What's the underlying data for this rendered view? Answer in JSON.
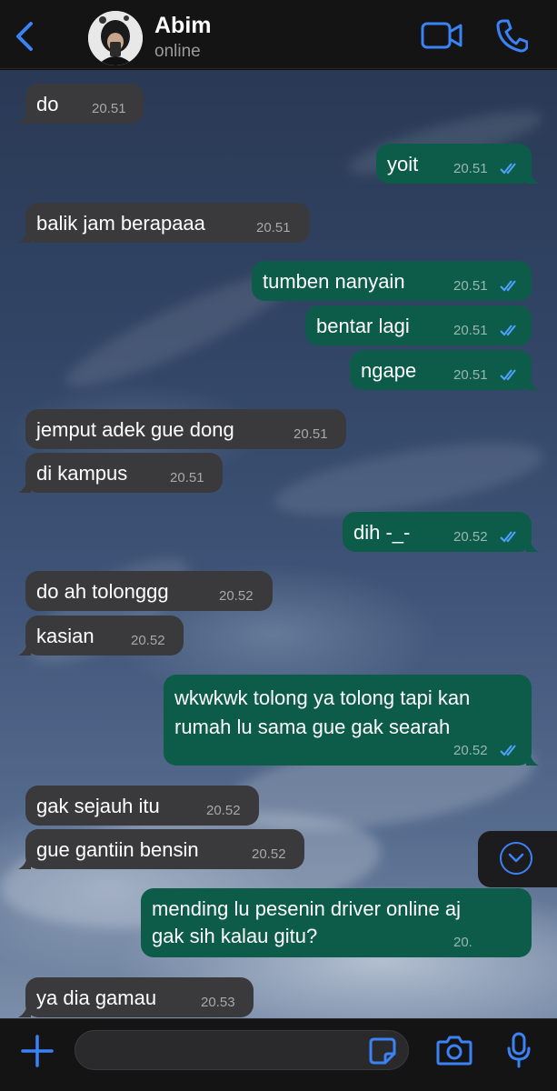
{
  "header": {
    "contact_name": "Abim",
    "status": "online"
  },
  "colors": {
    "accent": "#3b82f6",
    "incoming_bubble": "#3a3a3c",
    "outgoing_bubble": "#0d5c4a",
    "read_tick": "#4da3ff"
  },
  "messages": [
    {
      "dir": "in",
      "text": "do",
      "time": "20.51"
    },
    {
      "dir": "out",
      "text": "yoit",
      "time": "20.51",
      "status": "read"
    },
    {
      "dir": "in",
      "text": "balik jam berapaaa",
      "time": "20.51"
    },
    {
      "dir": "out",
      "text": "tumben nanyain",
      "time": "20.51",
      "status": "read"
    },
    {
      "dir": "out",
      "text": "bentar lagi",
      "time": "20.51",
      "status": "read"
    },
    {
      "dir": "out",
      "text": "ngape",
      "time": "20.51",
      "status": "read"
    },
    {
      "dir": "in",
      "text": "jemput adek gue dong",
      "time": "20.51"
    },
    {
      "dir": "in",
      "text": "di kampus",
      "time": "20.51"
    },
    {
      "dir": "out",
      "text": "dih -_-",
      "time": "20.52",
      "status": "read"
    },
    {
      "dir": "in",
      "text": "do ah tolonggg",
      "time": "20.52"
    },
    {
      "dir": "in",
      "text": "kasian",
      "time": "20.52"
    },
    {
      "dir": "out",
      "text": "wkwkwk tolong ya tolong tapi kan rumah lu sama gue gak searah",
      "line1": "wkwkwk tolong ya tolong tapi kan",
      "line2": "rumah lu sama gue gak searah",
      "time": "20.52",
      "status": "read"
    },
    {
      "dir": "in",
      "text": "gak sejauh itu",
      "time": "20.52"
    },
    {
      "dir": "in",
      "text": "gue gantiin bensin",
      "time": "20.52"
    },
    {
      "dir": "out",
      "text": "mending lu pesenin driver online aja gak sih kalau gitu?",
      "line1": "mending lu pesenin driver online aj",
      "line2": "gak sih kalau gitu?",
      "time": "20.",
      "status": "read"
    },
    {
      "dir": "in",
      "text": "ya dia gamau",
      "time": "20.53"
    }
  ],
  "composer": {
    "value": "",
    "placeholder": ""
  },
  "icons": {
    "back": "chevron-left-icon",
    "video": "video-camera-icon",
    "phone": "phone-icon",
    "scroll_down": "chevron-down-circle-icon",
    "attach": "plus-icon",
    "sticker": "sticker-icon",
    "camera": "camera-icon",
    "mic": "microphone-icon"
  }
}
